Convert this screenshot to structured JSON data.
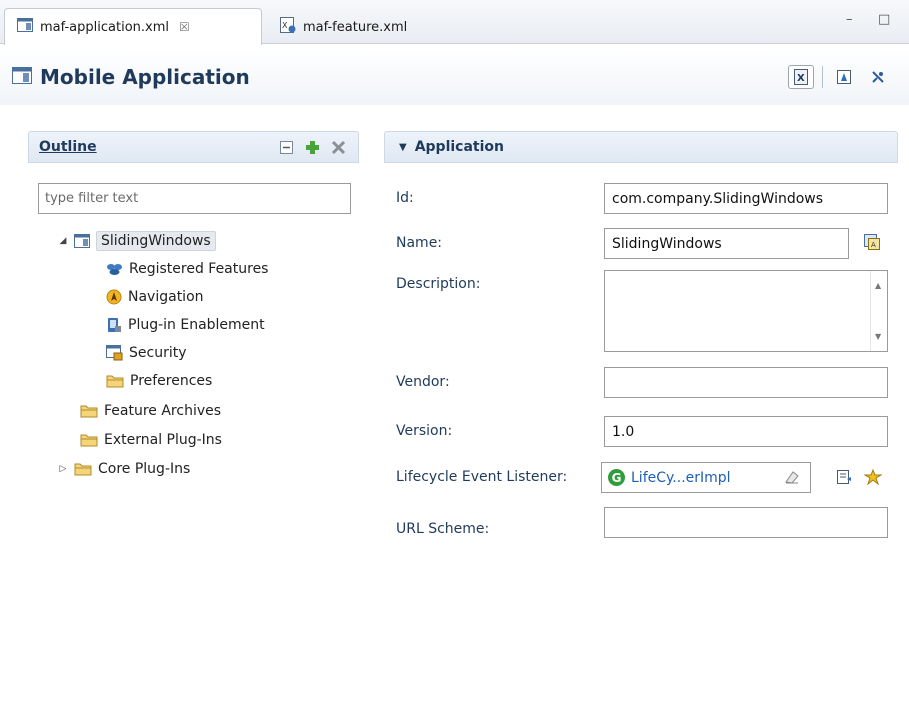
{
  "tabs": [
    {
      "label": "maf-application.xml",
      "icon": "app-descriptor-icon",
      "close": "☒"
    },
    {
      "label": "maf-feature.xml",
      "icon": "feature-xml-icon"
    }
  ],
  "window_controls": {
    "minimize": "–",
    "maximize": "□"
  },
  "editor": {
    "title": "Mobile Application",
    "icon": "app-descriptor-icon"
  },
  "header_actions": [
    "source-view-icon",
    "deploy-icon",
    "debug-icon"
  ],
  "outline": {
    "title": "Outline",
    "filter_placeholder": "type filter text",
    "tools": [
      "collapse-all-icon",
      "add-icon",
      "delete-icon"
    ],
    "tree": [
      {
        "label": "SlidingWindows",
        "icon": "app-descriptor-icon",
        "expander": "◢",
        "selected": true
      },
      {
        "label": "Registered Features",
        "icon": "features-icon"
      },
      {
        "label": "Navigation",
        "icon": "navigation-icon"
      },
      {
        "label": "Plug-in Enablement",
        "icon": "plugin-icon"
      },
      {
        "label": "Security",
        "icon": "security-icon"
      },
      {
        "label": "Preferences",
        "icon": "folder-icon"
      },
      {
        "label": "Feature Archives",
        "icon": "folder-icon"
      },
      {
        "label": "External Plug-Ins",
        "icon": "folder-icon"
      },
      {
        "label": "Core Plug-Ins",
        "icon": "folder-icon",
        "expander": "▷"
      }
    ]
  },
  "application": {
    "title": "Application",
    "fields": {
      "id": {
        "label": "Id:",
        "value": "com.company.SlidingWindows"
      },
      "name": {
        "label": "Name:",
        "value": "SlidingWindows"
      },
      "description": {
        "label": "Description:",
        "value": ""
      },
      "vendor": {
        "label": "Vendor:",
        "value": ""
      },
      "version": {
        "label": "Version:",
        "value": "1.0"
      },
      "lifecycle": {
        "label": "Lifecycle Event Listener:",
        "value": "LifeCy...erImpl"
      },
      "url_scheme": {
        "label": "URL Scheme:",
        "value": ""
      }
    }
  },
  "colors": {
    "accent": "#1f3a5a",
    "link": "#1d5fb8",
    "section_bg": "#dfe8f3"
  }
}
